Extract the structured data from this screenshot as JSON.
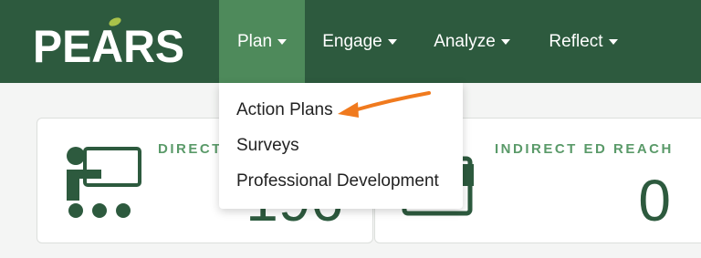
{
  "navbar": {
    "logo": {
      "text": "PEARS"
    },
    "items": [
      {
        "label": "Plan"
      },
      {
        "label": "Engage"
      },
      {
        "label": "Analyze"
      },
      {
        "label": "Reflect"
      }
    ]
  },
  "dropdown": {
    "items": [
      {
        "label": "Action Plans"
      },
      {
        "label": "Surveys"
      },
      {
        "label": "Professional Development"
      }
    ]
  },
  "cards": [
    {
      "title": "DIRECT",
      "value": "196",
      "icon": "presenter-icon"
    },
    {
      "title": "INDIRECT ED REACH",
      "value": "0",
      "icon": "document-icon"
    }
  ],
  "colors": {
    "navbar": "#2d5a3e",
    "nav_active": "#4e8a5b",
    "card_title": "#5a9a69",
    "card_value": "#2d5a3e",
    "annotation_arrow": "#f07a1e"
  }
}
